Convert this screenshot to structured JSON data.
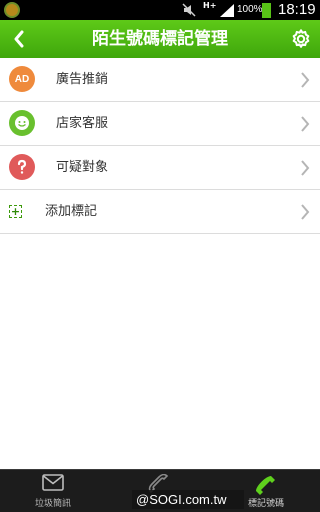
{
  "status_bar": {
    "network": "H+",
    "battery_percent": "100%",
    "clock": "18:19"
  },
  "header": {
    "title": "陌生號碼標記管理",
    "back_icon": "chevron-left-icon",
    "settings_icon": "gear-icon"
  },
  "list": {
    "items": [
      {
        "icon": "AD",
        "icon_color": "#ef8a3c",
        "label": "廣告推銷"
      },
      {
        "icon": "smiley-headset-icon",
        "icon_color": "#69c02e",
        "label": "店家客服"
      },
      {
        "icon": "question-mark-icon",
        "icon_color": "#e05a5a",
        "label": "可疑對象"
      }
    ],
    "add_item": {
      "icon": "+",
      "label": "添加標記"
    }
  },
  "bottom_nav": {
    "tabs": [
      {
        "label": "垃圾簡訊",
        "icon": "envelope-icon"
      },
      {
        "label": "",
        "icon": "phone-icon"
      },
      {
        "label": "標記號碼",
        "icon": "tag-phone-icon",
        "active": true
      }
    ]
  },
  "watermark": "@SOGI.com.tw",
  "colors": {
    "header_green": "#4cb812",
    "accent_green": "#3d9a0c"
  }
}
